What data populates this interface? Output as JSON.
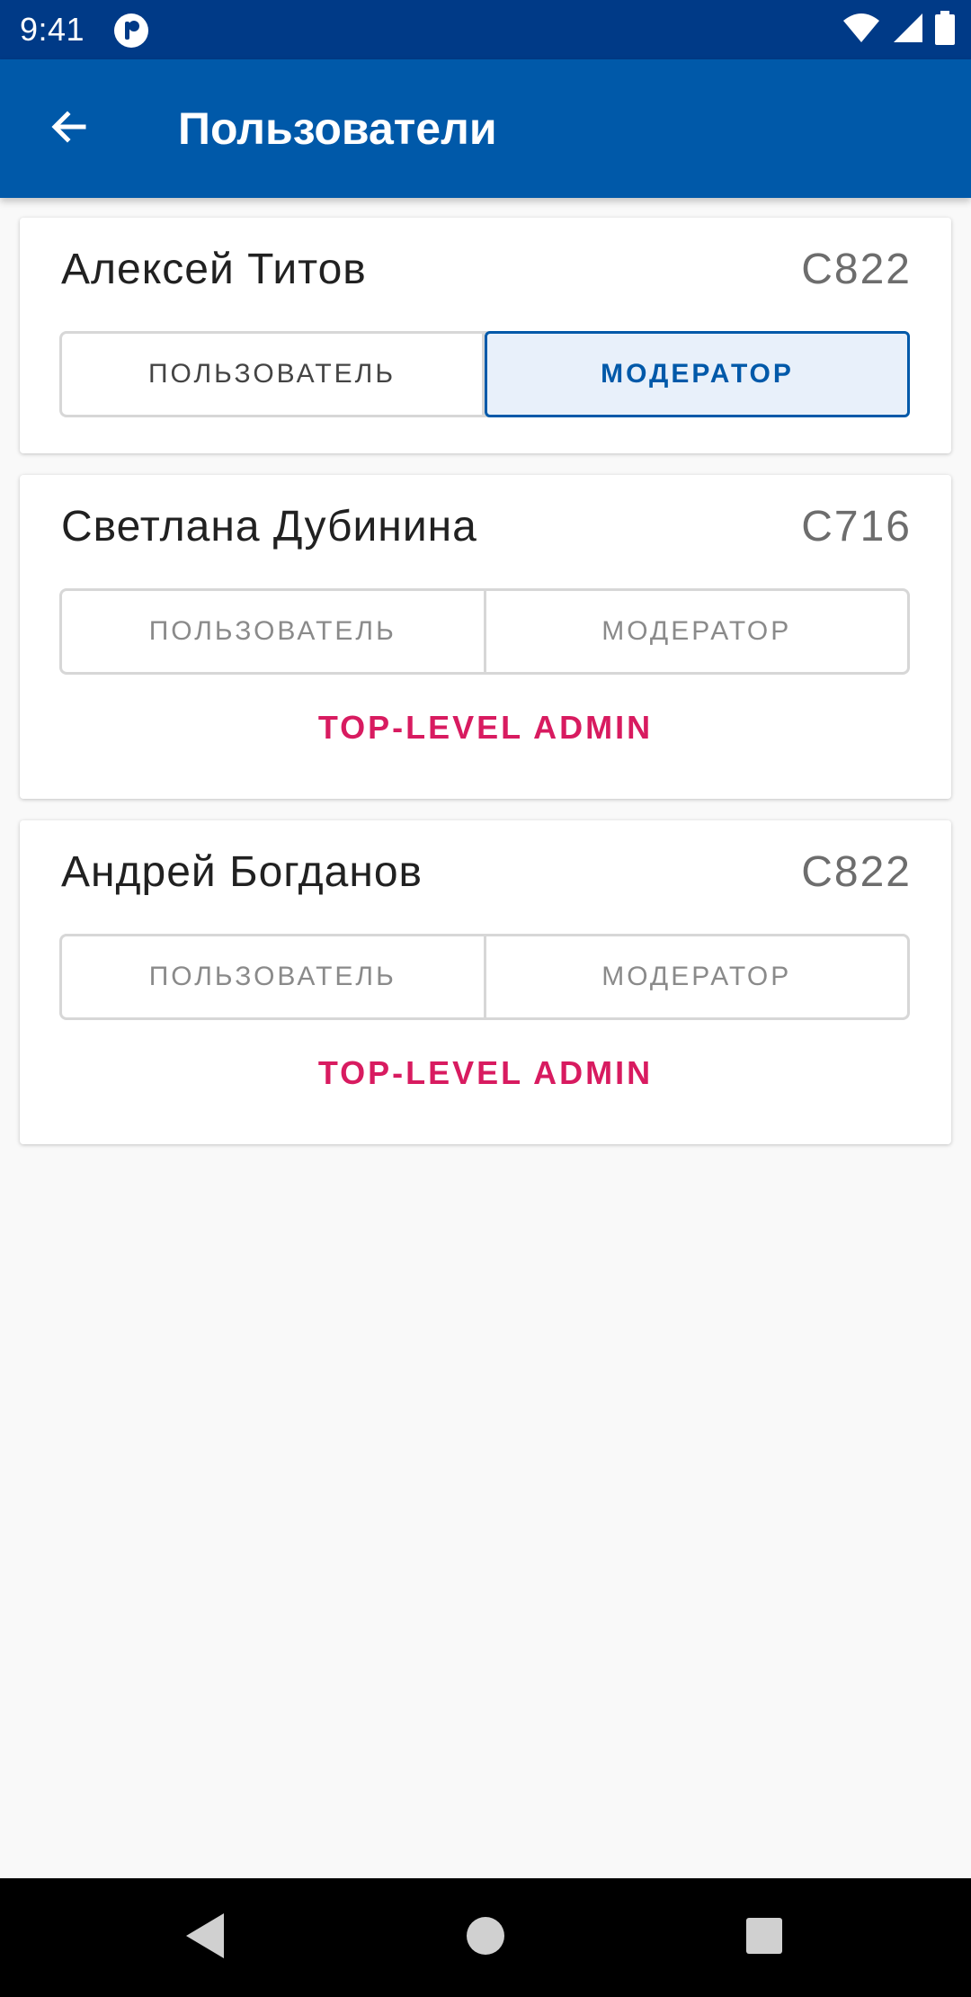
{
  "status_bar": {
    "time": "9:41"
  },
  "app_bar": {
    "title": "Пользователи"
  },
  "colors": {
    "primary": "#0059a9",
    "status_bar": "#003a87",
    "accent": "#d81b60"
  },
  "users": [
    {
      "name": "Алексей Титов",
      "code": "C822",
      "role_user_label": "ПОЛЬЗОВАТЕЛЬ",
      "role_moderator_label": "МОДЕРАТОР",
      "selected_role": "МОДЕРАТОР"
    },
    {
      "name": "Светлана Дубинина",
      "code": "C716",
      "role_user_label": "ПОЛЬЗОВАТЕЛЬ",
      "role_moderator_label": "МОДЕРАТОР",
      "admin_label": "TOP-LEVEL ADMIN"
    },
    {
      "name": "Андрей Богданов",
      "code": "C822",
      "role_user_label": "ПОЛЬЗОВАТЕЛЬ",
      "role_moderator_label": "МОДЕРАТОР",
      "admin_label": "TOP-LEVEL ADMIN"
    }
  ],
  "icons": {
    "status_app": "notification-app-icon",
    "wifi": "wifi-icon",
    "signal": "cell-signal-icon",
    "battery": "battery-icon",
    "back": "arrow-back-icon",
    "nav_back": "nav-back-icon",
    "nav_home": "nav-home-icon",
    "nav_recents": "nav-recents-icon"
  }
}
